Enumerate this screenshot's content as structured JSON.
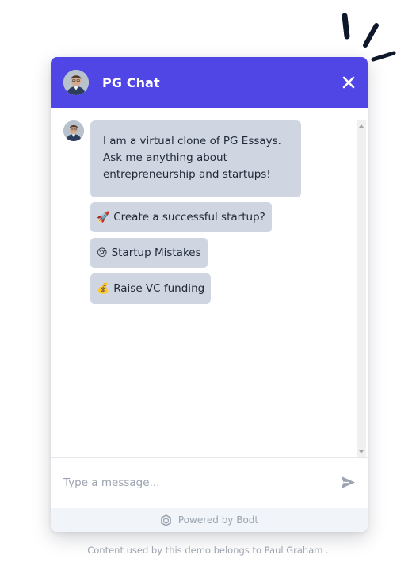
{
  "header": {
    "title": "PG Chat",
    "accent_color": "#5046e5",
    "avatar_icon": "user-avatar",
    "close_icon": "close-icon"
  },
  "conversation": {
    "bot_message": "I am a virtual clone of PG Essays. Ask me anything about entrepreneurship and startups!",
    "suggestions": [
      {
        "emoji": "🚀",
        "label": "Create a successful startup?"
      },
      {
        "emoji": "😢",
        "label": "Startup Mistakes"
      },
      {
        "emoji": "💰",
        "label": "Raise VC funding"
      }
    ],
    "bubble_color": "#cfd6e2"
  },
  "composer": {
    "placeholder": "Type a message...",
    "value": "",
    "send_icon": "send-icon"
  },
  "branding": {
    "label": "Powered by Bodt",
    "icon": "hexagon-logo-icon"
  },
  "footer": {
    "text": "Content used by this demo belongs to Paul Graham ."
  }
}
